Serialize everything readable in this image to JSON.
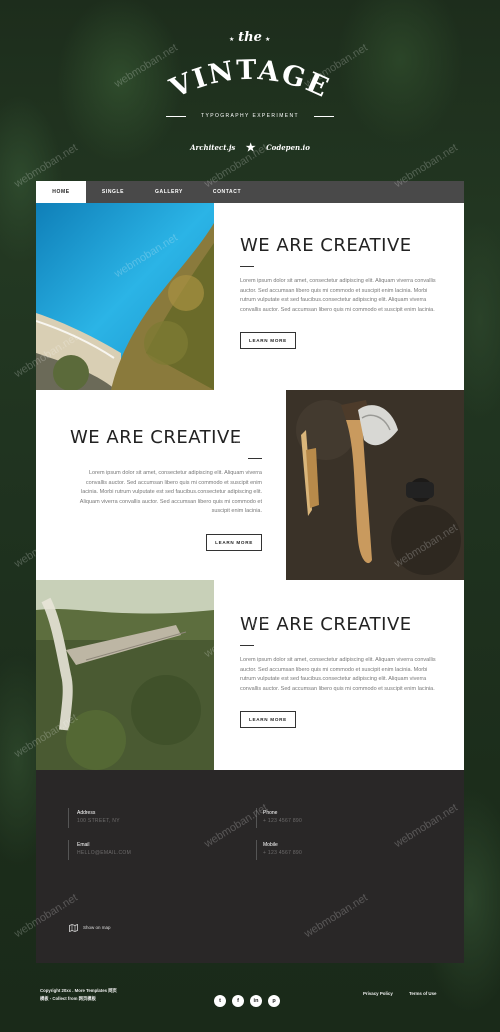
{
  "brand": {
    "the": "the",
    "name": "VINTAGE",
    "tagline": "TYPOGRAPHY EXPERIMENT",
    "link_left": "Architect.js",
    "link_right": "Codepen.io"
  },
  "nav": {
    "items": [
      "HOME",
      "SINGLE",
      "GALLERY",
      "CONTACT"
    ],
    "active": "HOME"
  },
  "sections": [
    {
      "heading": "WE ARE CREATIVE",
      "body": "Lorem ipsum dolor sit amet, consectetur adipiscing elit. Aliquam viverra convallis auctor. Sed accumsan libero quis mi commodo et suscipit enim lacinia. Morbi rutrum vulputate est sed faucibus.consectetur adipiscing elit. Aliquam viverra convallis auctor. Sed accumsan libero quis mi commodo et suscipit enim lacinia.",
      "button": "LEARN MORE",
      "image": "aerial-beach-photo"
    },
    {
      "heading": "WE ARE CREATIVE",
      "body": "Lorem ipsum dolor sit amet, consectetur adipiscing elit. Aliquam viverra convallis auctor. Sed accumsan libero quis mi commodo et suscipit enim lacinia. Morbi rutrum vulputate est sed faucibus.consectetur adipiscing elit. Aliquam viverra convallis auctor. Sed accumsan libero quis mi commodo et suscipit enim lacinia.",
      "button": "LEARN MORE",
      "image": "axe-and-knife-photo"
    },
    {
      "heading": "WE ARE CREATIVE",
      "body": "Lorem ipsum dolor sit amet, consectetur adipiscing elit. Aliquam viverra convallis auctor. Sed accumsan libero quis mi commodo et suscipit enim lacinia. Morbi rutrum vulputate est sed faucibus.consectetur adipiscing elit. Aliquam viverra convallis auctor. Sed accumsan libero quis mi commodo et suscipit enim lacinia.",
      "button": "LEARN MORE",
      "image": "forest-bridge-photo"
    }
  ],
  "footer": {
    "address_label": "Address",
    "address_value": "100 STREET, NY",
    "phone_label": "Phone",
    "phone_value": "+ 123 4567 890",
    "email_label": "Email",
    "email_value": "HELLO@EMAIL.COM",
    "mobile_label": "Mobile",
    "mobile_value": "+ 123 4567 890",
    "map_link": "Show on map"
  },
  "bottom": {
    "copyright_line1": "Copyright 20xx . More Templates 网页",
    "copyright_line2": "模板 - Collect from 网页模板",
    "socials": [
      "twitter-icon",
      "facebook-icon",
      "linkedin-icon",
      "pinterest-icon"
    ],
    "privacy": "Privacy Policy",
    "terms": "Terms of Use"
  },
  "watermark": "webmoban.net",
  "colors": {
    "forest_bg": "#1f321f",
    "nav_bg": "#494949",
    "footer_bg": "#292727",
    "text_dark": "#222222"
  }
}
